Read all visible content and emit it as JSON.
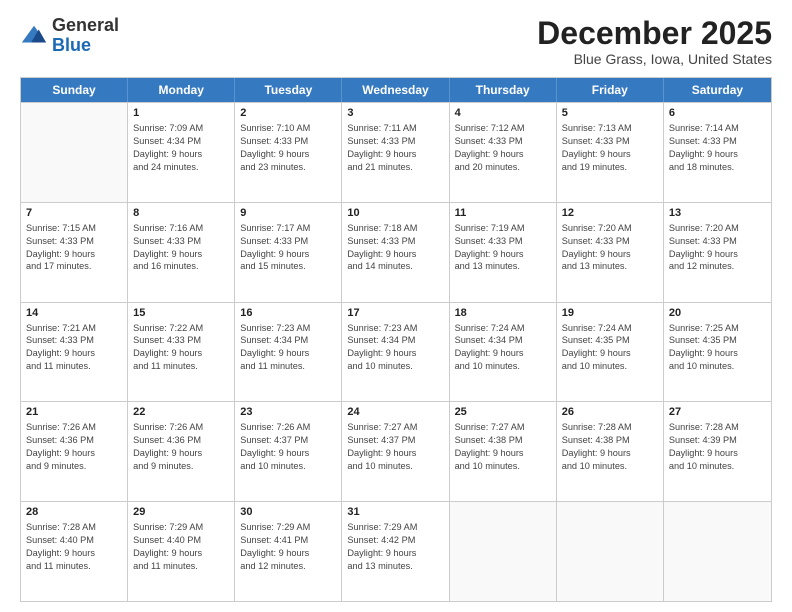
{
  "logo": {
    "general": "General",
    "blue": "Blue"
  },
  "title": "December 2025",
  "subtitle": "Blue Grass, Iowa, United States",
  "headers": [
    "Sunday",
    "Monday",
    "Tuesday",
    "Wednesday",
    "Thursday",
    "Friday",
    "Saturday"
  ],
  "weeks": [
    [
      {
        "day": "",
        "info": ""
      },
      {
        "day": "1",
        "info": "Sunrise: 7:09 AM\nSunset: 4:34 PM\nDaylight: 9 hours\nand 24 minutes."
      },
      {
        "day": "2",
        "info": "Sunrise: 7:10 AM\nSunset: 4:33 PM\nDaylight: 9 hours\nand 23 minutes."
      },
      {
        "day": "3",
        "info": "Sunrise: 7:11 AM\nSunset: 4:33 PM\nDaylight: 9 hours\nand 21 minutes."
      },
      {
        "day": "4",
        "info": "Sunrise: 7:12 AM\nSunset: 4:33 PM\nDaylight: 9 hours\nand 20 minutes."
      },
      {
        "day": "5",
        "info": "Sunrise: 7:13 AM\nSunset: 4:33 PM\nDaylight: 9 hours\nand 19 minutes."
      },
      {
        "day": "6",
        "info": "Sunrise: 7:14 AM\nSunset: 4:33 PM\nDaylight: 9 hours\nand 18 minutes."
      }
    ],
    [
      {
        "day": "7",
        "info": "Sunrise: 7:15 AM\nSunset: 4:33 PM\nDaylight: 9 hours\nand 17 minutes."
      },
      {
        "day": "8",
        "info": "Sunrise: 7:16 AM\nSunset: 4:33 PM\nDaylight: 9 hours\nand 16 minutes."
      },
      {
        "day": "9",
        "info": "Sunrise: 7:17 AM\nSunset: 4:33 PM\nDaylight: 9 hours\nand 15 minutes."
      },
      {
        "day": "10",
        "info": "Sunrise: 7:18 AM\nSunset: 4:33 PM\nDaylight: 9 hours\nand 14 minutes."
      },
      {
        "day": "11",
        "info": "Sunrise: 7:19 AM\nSunset: 4:33 PM\nDaylight: 9 hours\nand 13 minutes."
      },
      {
        "day": "12",
        "info": "Sunrise: 7:20 AM\nSunset: 4:33 PM\nDaylight: 9 hours\nand 13 minutes."
      },
      {
        "day": "13",
        "info": "Sunrise: 7:20 AM\nSunset: 4:33 PM\nDaylight: 9 hours\nand 12 minutes."
      }
    ],
    [
      {
        "day": "14",
        "info": "Sunrise: 7:21 AM\nSunset: 4:33 PM\nDaylight: 9 hours\nand 11 minutes."
      },
      {
        "day": "15",
        "info": "Sunrise: 7:22 AM\nSunset: 4:33 PM\nDaylight: 9 hours\nand 11 minutes."
      },
      {
        "day": "16",
        "info": "Sunrise: 7:23 AM\nSunset: 4:34 PM\nDaylight: 9 hours\nand 11 minutes."
      },
      {
        "day": "17",
        "info": "Sunrise: 7:23 AM\nSunset: 4:34 PM\nDaylight: 9 hours\nand 10 minutes."
      },
      {
        "day": "18",
        "info": "Sunrise: 7:24 AM\nSunset: 4:34 PM\nDaylight: 9 hours\nand 10 minutes."
      },
      {
        "day": "19",
        "info": "Sunrise: 7:24 AM\nSunset: 4:35 PM\nDaylight: 9 hours\nand 10 minutes."
      },
      {
        "day": "20",
        "info": "Sunrise: 7:25 AM\nSunset: 4:35 PM\nDaylight: 9 hours\nand 10 minutes."
      }
    ],
    [
      {
        "day": "21",
        "info": "Sunrise: 7:26 AM\nSunset: 4:36 PM\nDaylight: 9 hours\nand 9 minutes."
      },
      {
        "day": "22",
        "info": "Sunrise: 7:26 AM\nSunset: 4:36 PM\nDaylight: 9 hours\nand 9 minutes."
      },
      {
        "day": "23",
        "info": "Sunrise: 7:26 AM\nSunset: 4:37 PM\nDaylight: 9 hours\nand 10 minutes."
      },
      {
        "day": "24",
        "info": "Sunrise: 7:27 AM\nSunset: 4:37 PM\nDaylight: 9 hours\nand 10 minutes."
      },
      {
        "day": "25",
        "info": "Sunrise: 7:27 AM\nSunset: 4:38 PM\nDaylight: 9 hours\nand 10 minutes."
      },
      {
        "day": "26",
        "info": "Sunrise: 7:28 AM\nSunset: 4:38 PM\nDaylight: 9 hours\nand 10 minutes."
      },
      {
        "day": "27",
        "info": "Sunrise: 7:28 AM\nSunset: 4:39 PM\nDaylight: 9 hours\nand 10 minutes."
      }
    ],
    [
      {
        "day": "28",
        "info": "Sunrise: 7:28 AM\nSunset: 4:40 PM\nDaylight: 9 hours\nand 11 minutes."
      },
      {
        "day": "29",
        "info": "Sunrise: 7:29 AM\nSunset: 4:40 PM\nDaylight: 9 hours\nand 11 minutes."
      },
      {
        "day": "30",
        "info": "Sunrise: 7:29 AM\nSunset: 4:41 PM\nDaylight: 9 hours\nand 12 minutes."
      },
      {
        "day": "31",
        "info": "Sunrise: 7:29 AM\nSunset: 4:42 PM\nDaylight: 9 hours\nand 13 minutes."
      },
      {
        "day": "",
        "info": ""
      },
      {
        "day": "",
        "info": ""
      },
      {
        "day": "",
        "info": ""
      }
    ]
  ]
}
